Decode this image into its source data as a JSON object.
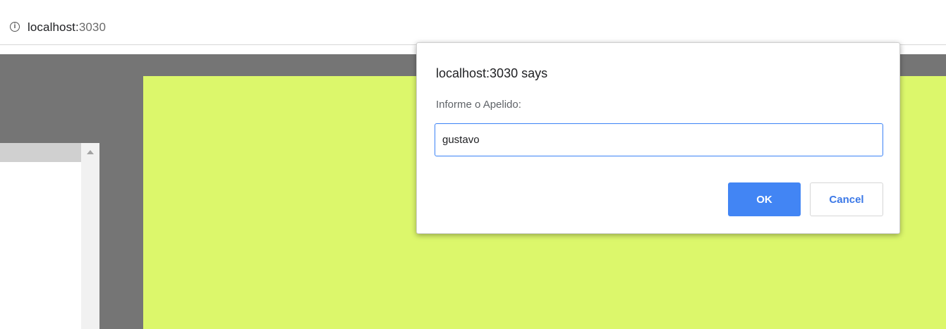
{
  "browser": {
    "url_host": "localhost:",
    "url_port": "3030",
    "info_icon": "info-icon"
  },
  "dialog": {
    "title": "localhost:3030 says",
    "message": "Informe o Apelido:",
    "input_value": "gustavo",
    "ok_label": "OK",
    "cancel_label": "Cancel"
  },
  "colors": {
    "page_background": "#757575",
    "green_area": "#dcf76b",
    "ok_button": "#4285f4",
    "cancel_text": "#3b78e7"
  }
}
